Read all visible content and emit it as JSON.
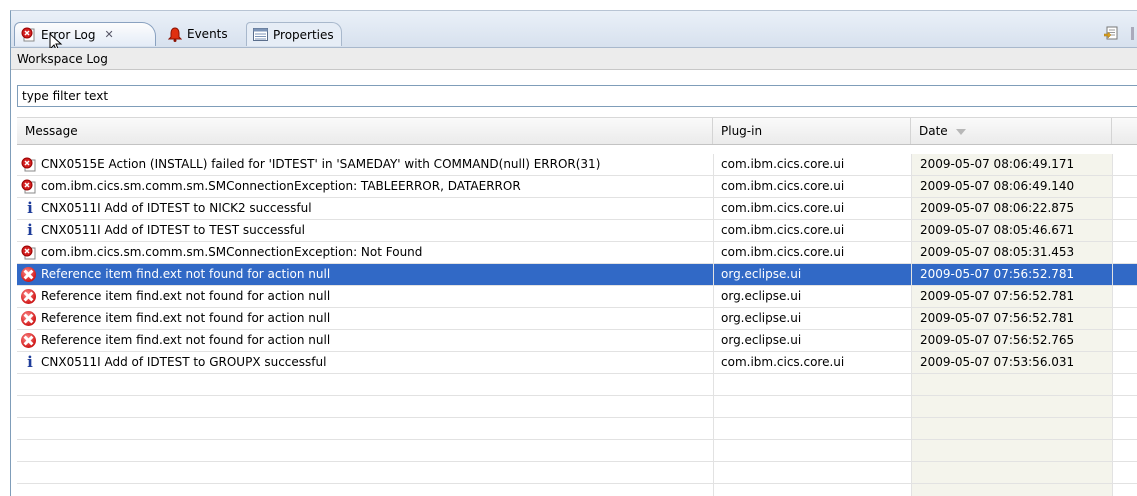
{
  "tabs": [
    {
      "label": "Error Log",
      "active": true,
      "icon": "error-log-icon"
    },
    {
      "label": "Events",
      "active": false,
      "icon": "bell-icon"
    },
    {
      "label": "Properties",
      "active": false,
      "icon": "properties-icon"
    }
  ],
  "tab_close_glyph": "✕",
  "log_title": "Workspace Log",
  "filter": {
    "value": "type filter text"
  },
  "columns": {
    "message": "Message",
    "plugin": "Plug-in",
    "date": "Date"
  },
  "rows": [
    {
      "severity": "error-detailed",
      "message": "CNX0515E Action (INSTALL) failed for 'IDTEST' in 'SAMEDAY' with COMMAND(null) ERROR(31)",
      "plugin": "com.ibm.cics.core.ui",
      "date": "2009-05-07 08:06:49.171"
    },
    {
      "severity": "error-detailed",
      "message": "com.ibm.cics.sm.comm.sm.SMConnectionException: TABLEERROR, DATAERROR",
      "plugin": "com.ibm.cics.core.ui",
      "date": "2009-05-07 08:06:49.140"
    },
    {
      "severity": "info",
      "message": "CNX0511I Add of IDTEST to NICK2 successful",
      "plugin": "com.ibm.cics.core.ui",
      "date": "2009-05-07 08:06:22.875"
    },
    {
      "severity": "info",
      "message": "CNX0511I Add of IDTEST to TEST successful",
      "plugin": "com.ibm.cics.core.ui",
      "date": "2009-05-07 08:05:46.671"
    },
    {
      "severity": "error-detailed",
      "message": "com.ibm.cics.sm.comm.sm.SMConnectionException: Not Found",
      "plugin": "com.ibm.cics.core.ui",
      "date": "2009-05-07 08:05:31.453"
    },
    {
      "severity": "error",
      "message": "Reference item find.ext not found for action null",
      "plugin": "org.eclipse.ui",
      "date": "2009-05-07 07:56:52.781",
      "selected": true
    },
    {
      "severity": "error",
      "message": "Reference item find.ext not found for action null",
      "plugin": "org.eclipse.ui",
      "date": "2009-05-07 07:56:52.781"
    },
    {
      "severity": "error",
      "message": "Reference item find.ext not found for action null",
      "plugin": "org.eclipse.ui",
      "date": "2009-05-07 07:56:52.781"
    },
    {
      "severity": "error",
      "message": "Reference item find.ext not found for action null",
      "plugin": "org.eclipse.ui",
      "date": "2009-05-07 07:56:52.765"
    },
    {
      "severity": "info",
      "message": "CNX0511I Add of IDTEST to GROUPX successful",
      "plugin": "com.ibm.cics.core.ui",
      "date": "2009-05-07 07:53:56.031"
    }
  ],
  "colors": {
    "selection": "#3169c6",
    "error": "#d42020",
    "info": "#1f3d9a"
  }
}
